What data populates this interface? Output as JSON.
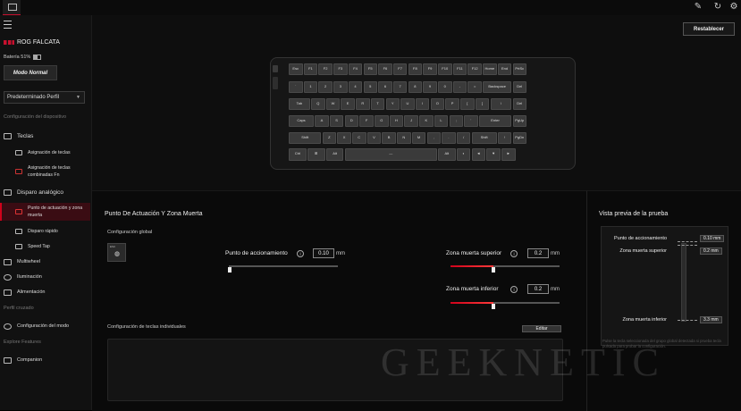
{
  "topbar": {
    "icons": [
      "brush-icon",
      "refresh-icon",
      "settings-icon"
    ]
  },
  "sidebar": {
    "device_name": "ROG FALCATA",
    "battery": "Batería 51%",
    "mode_button": "Modo Normal",
    "profile_select": "Predeterminado Perfil",
    "section_device_config": "Configuración del dispositivo",
    "teclas": "Teclas",
    "asignacion_teclas": "Asignación de teclas",
    "asignacion_combinadas": "Asignación de teclas combinadas Fn",
    "disparo_analogico": "Disparo analógico",
    "punto_actuacion": "Punto de actuación y zona muerta",
    "disparo_rapido": "Disparo rápido",
    "speed_tap": "Speed Tap",
    "multiwheel": "Multiwheel",
    "iluminacion": "Iluminación",
    "alimentacion": "Alimentación",
    "section_perfil_cruzado": "Perfil cruzado",
    "config_modo": "Configuración del modo",
    "section_explore": "Explore Features",
    "companion": "Companion"
  },
  "toolbar": {
    "reset_label": "Restablecer"
  },
  "keyboard": {
    "rows": [
      [
        "Esc",
        "F1",
        "F2",
        "F3",
        "F4",
        "F5",
        "F6",
        "F7",
        "F8",
        "F9",
        "F10",
        "F11",
        "F12",
        "Home",
        "End",
        "PrtSc"
      ],
      [
        "`",
        "1",
        "2",
        "3",
        "4",
        "5",
        "6",
        "7",
        "8",
        "9",
        "0",
        "-",
        "=",
        "Backspace",
        "Del"
      ],
      [
        "Tab",
        "Q",
        "W",
        "E",
        "R",
        "T",
        "Y",
        "U",
        "I",
        "O",
        "P",
        "[",
        "]",
        "\\",
        "Del"
      ],
      [
        "Caps",
        "A",
        "S",
        "D",
        "F",
        "G",
        "H",
        "J",
        "K",
        "L",
        ";",
        "'",
        "Enter",
        "PgUp"
      ],
      [
        "Shift",
        "Z",
        "X",
        "C",
        "V",
        "B",
        "N",
        "M",
        ",",
        ".",
        "/",
        "Shift",
        "↑",
        "PgDn"
      ],
      [
        "Ctrl",
        "⊞",
        "Alt",
        "—",
        "Alt",
        "◐",
        "◄",
        "▼",
        "►"
      ]
    ]
  },
  "main": {
    "title": "Punto De Actuación Y Zona Muerta",
    "global_config": "Configuración global",
    "actuation_label": "Punto de accionamiento",
    "actuation_value": "0.10",
    "unit": "mm",
    "upper_dz_label": "Zona muerta superior",
    "upper_dz_value": "0.2",
    "lower_dz_label": "Zona muerta inferior",
    "lower_dz_value": "0.2",
    "individual_config": "Configuración de teclas individuales",
    "edit_button": "Editar"
  },
  "preview": {
    "title": "Vista previa de la prueba",
    "actuation_label": "Punto de accionamiento",
    "actuation_value": "0.10 mm",
    "upper_label": "Zona muerta superior",
    "upper_value": "0.2 mm",
    "lower_label": "Zona muerta inferior",
    "lower_value": "3.3 mm",
    "hint": "Pulse la tecla seleccionada del grupo global detectada si prueba tecla pulsada para probar la configuración."
  },
  "watermark": "GEEKNETIC"
}
